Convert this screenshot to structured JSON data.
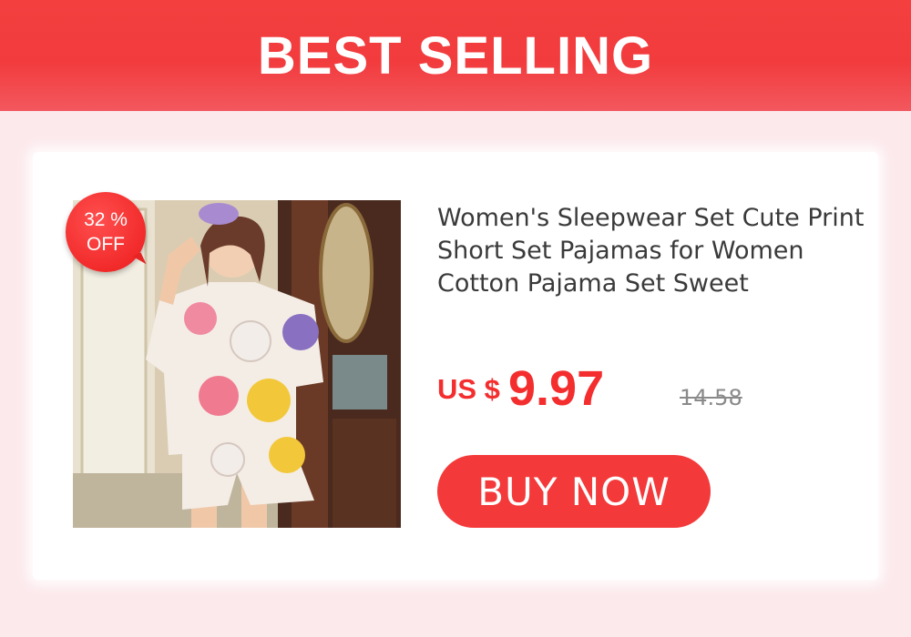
{
  "header": {
    "title": "BEST SELLING"
  },
  "badge": {
    "discount": "32 %",
    "label": "OFF"
  },
  "product": {
    "title": "Women's Sleepwear Set Cute Print Short Set Pajamas for Women Cotton Pajama Set Sweet",
    "currency": "US $",
    "price": "9.97",
    "original_price": "14.58"
  },
  "buy_button": {
    "label": "BUY  NOW"
  },
  "colors": {
    "accent": "#f4393a",
    "header_bg": "#f3403f",
    "page_bg": "#fce9ec",
    "price": "#f42e2e",
    "old_price": "#8a8a8a"
  },
  "icons": {
    "product_photo": "pajama-model-photo"
  }
}
